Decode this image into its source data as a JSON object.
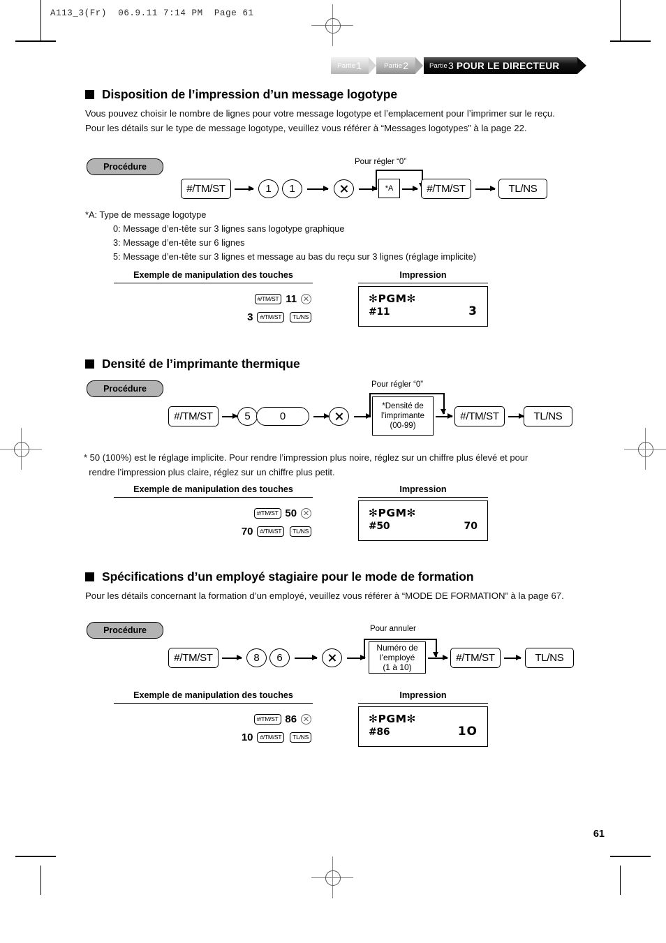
{
  "file_stamp": "A113_3(Fr)  06.9.11 7:14 PM  Page 61",
  "banner": {
    "tab1_label": "Partie",
    "tab1_num": "1",
    "tab2_label": "Partie",
    "tab2_num": "2",
    "tab3_label": "Partie",
    "tab3_num": "3",
    "tab3_title": "POUR LE DIRECTEUR"
  },
  "common": {
    "procedure_badge": "Procédure",
    "col_keys": "Exemple de manipulation des touches",
    "col_print": "Impression",
    "key_tmst": "#/TM/ST",
    "key_tlns": "TL/NS",
    "receipt_header": "✻PGM✻"
  },
  "sections": [
    {
      "heading": "Disposition de l’impression d’un message logotype",
      "body": "Vous pouvez choisir le nombre de lignes pour votre message logotype et l’emplacement pour l’imprimer sur le reçu.\nPour les détails sur le type de message logotype, veuillez vous référer à “Messages logotypes” à la page 22.",
      "flow": {
        "cancel_label": "Pour régler “0”",
        "digit1": "1",
        "digit2": "1",
        "param_box": "*A"
      },
      "notes": {
        "title": "*A:  Type de message logotype",
        "items": [
          "0:  Message d’en-tête sur 3 lignes sans logotype graphique",
          "3:  Message d’en-tête sur 6 lignes",
          "5:  Message d’en-tête sur 3 lignes et message au bas du reçu sur 3 lignes (réglage implicite)"
        ]
      },
      "example": {
        "line1_code": "11",
        "line2_value": "3"
      },
      "print": {
        "code": "#11",
        "value": "3"
      }
    },
    {
      "heading": "Densité de l’imprimante thermique",
      "flow": {
        "cancel_label": "Pour régler “0”",
        "digit1": "5",
        "digit2": "0",
        "param_line1": "*Densité de",
        "param_line2": "l’imprimante",
        "param_line3": "(00-99)"
      },
      "footnote": "* 50 (100%) est le réglage implicite. Pour rendre l’impression plus noire, réglez sur un chiffre plus élevé et pour\n  rendre l’impression plus claire, réglez sur un chiffre plus petit.",
      "example": {
        "line1_code": "50",
        "line2_value": "70"
      },
      "print": {
        "code": "#50",
        "value": "70"
      }
    },
    {
      "heading": "Spécifications d’un employé stagiaire pour le mode de formation",
      "body": "Pour les détails concernant la formation d’un employé, veuillez vous référer à “MODE DE FORMATION” à la page 67.",
      "flow": {
        "cancel_label": "Pour annuler",
        "digit1": "8",
        "digit2": "6",
        "param_line1": "Numéro de",
        "param_line2": "l’employé",
        "param_line3": "(1 à 10)"
      },
      "example": {
        "line1_code": "86",
        "line2_value": "10"
      },
      "print": {
        "code": "#86",
        "value": "1O"
      }
    }
  ],
  "page_number": "61"
}
